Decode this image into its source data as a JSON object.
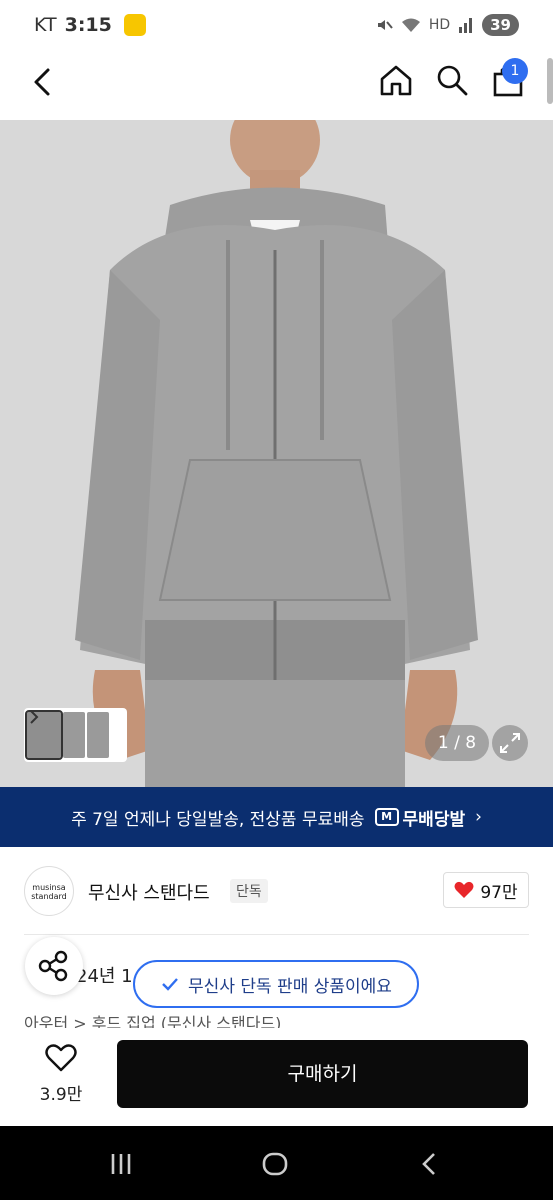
{
  "status_bar": {
    "carrier": "KT",
    "time": "3:15",
    "network": "HD",
    "battery": "39"
  },
  "nav": {
    "cart_count": "1"
  },
  "gallery": {
    "counter": "1 / 8"
  },
  "promo": {
    "text": "주 7일 언제나 당일발송, 전상품 무료배송",
    "badge_icon": "M",
    "badge_text": "무배당발",
    "chevron": "›"
  },
  "brand": {
    "logo_line1": "musinsa",
    "logo_line2": "standard",
    "name": "무신사 스탠다드",
    "tag": "단독",
    "likes": "97만"
  },
  "info": {
    "date_partial": "24년 1",
    "category_partial": "아우터 > 후드 집업 (무신사 스탠다드)"
  },
  "toast": {
    "text": "무신사 단독 판매 상품이에요"
  },
  "action_bar": {
    "wish_count": "3.9만",
    "buy_label": "구매하기"
  },
  "colors": {
    "promo_bg": "#0b2e6f",
    "accent": "#2f6ef0",
    "buy_bg": "#0b0b0b",
    "heart": "#e8262a"
  }
}
